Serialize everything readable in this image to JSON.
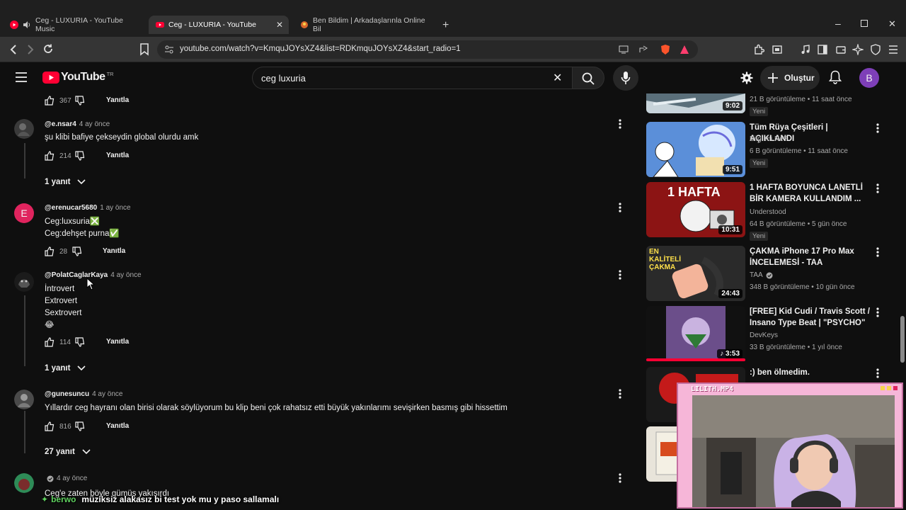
{
  "browser": {
    "tabs": [
      {
        "label": "Ceg - LUXURIA - YouTube Music"
      },
      {
        "label": "Ceg - LUXURIA - YouTube"
      },
      {
        "label": "Ben Bildim | Arkadaşlarınla Online Bil"
      }
    ],
    "url": "youtube.com/watch?v=KmquJOYsXZ4&list=RDKmquJOYsXZ4&start_radio=1"
  },
  "youtube": {
    "logo_text": "YouTube",
    "region": "TR",
    "search_value": "ceg luxuria",
    "create_label": "Oluştur",
    "avatar_letter": "B"
  },
  "comments": {
    "top": {
      "likes": "367",
      "reply_label": "Yanıtla"
    },
    "items": [
      {
        "author": "@e.nsar4",
        "ago": "4 ay önce",
        "lines": [
          "şu klibi bafiye çekseydin global olurdu amk"
        ],
        "likes": "214",
        "reply_label": "Yanıtla",
        "replies_toggle": "1 yanıt"
      },
      {
        "author": "@erenucar5680",
        "ago": "1 ay önce",
        "avatar_letter": "E",
        "lines": [
          "Ceg:luxsuria❎",
          "Ceg:dehşet purna✅"
        ],
        "likes": "28",
        "reply_label": "Yanıtla"
      },
      {
        "author": "@PolatCaglarKaya",
        "ago": "4 ay önce",
        "lines": [
          "İntrovert",
          "Extrovert",
          "Sextrovert",
          "😂"
        ],
        "likes": "114",
        "reply_label": "Yanıtla",
        "replies_toggle": "1 yanıt"
      },
      {
        "author": "@gunesuncu",
        "ago": "4 ay önce",
        "lines": [
          "Yıllardır ceg hayranı olan birisi olarak söylüyorum bu klip beni çok rahatsız etti büyük yakınlarımı sevişirken basmış gibi hissettim"
        ],
        "likes": "816",
        "reply_label": "Yanıtla",
        "replies_toggle": "27 yanıt"
      },
      {
        "author": "",
        "ago": "4 ay önce",
        "lines": [
          "Ceg'e zaten böyle gümüş yakışırdı"
        ]
      }
    ]
  },
  "sidebar": {
    "videos": [
      {
        "title": "",
        "channel": "",
        "meta": "21 B görüntüleme • 11 saat önce",
        "badge": "Yeni",
        "duration": "9:02"
      },
      {
        "title": "Tüm Rüya Çeşitleri | AÇIKLANDI",
        "channel": "Bilgi mi Ne?",
        "meta": "6 B görüntüleme • 11 saat önce",
        "badge": "Yeni",
        "duration": "9:51"
      },
      {
        "title": "1 HAFTA BOYUNCA LANETLİ BİR KAMERA KULLANDIM ...",
        "channel": "Understood",
        "meta": "64 B görüntüleme • 5 gün önce",
        "badge": "Yeni",
        "duration": "10:31",
        "thumb_text": "1 HAFTA"
      },
      {
        "title": "ÇAKMA iPhone 17 Pro Max İNCELEMESİ - TAA",
        "channel": "TAA",
        "meta": "348 B görüntüleme • 10 gün önce",
        "duration": "24:43",
        "thumb_text": "EN KALİTELİ ÇAKMA"
      },
      {
        "title": "[FREE] Kid Cudi / Travis Scott / Insano Type Beat | \"PSYCHO\"",
        "channel": "DevKeys",
        "meta": "33 B görüntüleme • 1 yıl önce",
        "duration": "3:53"
      },
      {
        "title": ":) ben ölmedim."
      }
    ]
  },
  "overlay": {
    "webcam_title": "LILITH.MP4",
    "chat_user": "berwo",
    "chat_message": "müziksiz alakasız bi test yok mu y paso sallamalı"
  },
  "colors": {
    "background": "#0f0f0f",
    "youtube_red": "#ff0033",
    "avatar_e": "#e0245e",
    "avatar_me": "#7e3fb8",
    "webcam_frame": "#f6b6d8",
    "chat_user": "#5fd15f"
  }
}
